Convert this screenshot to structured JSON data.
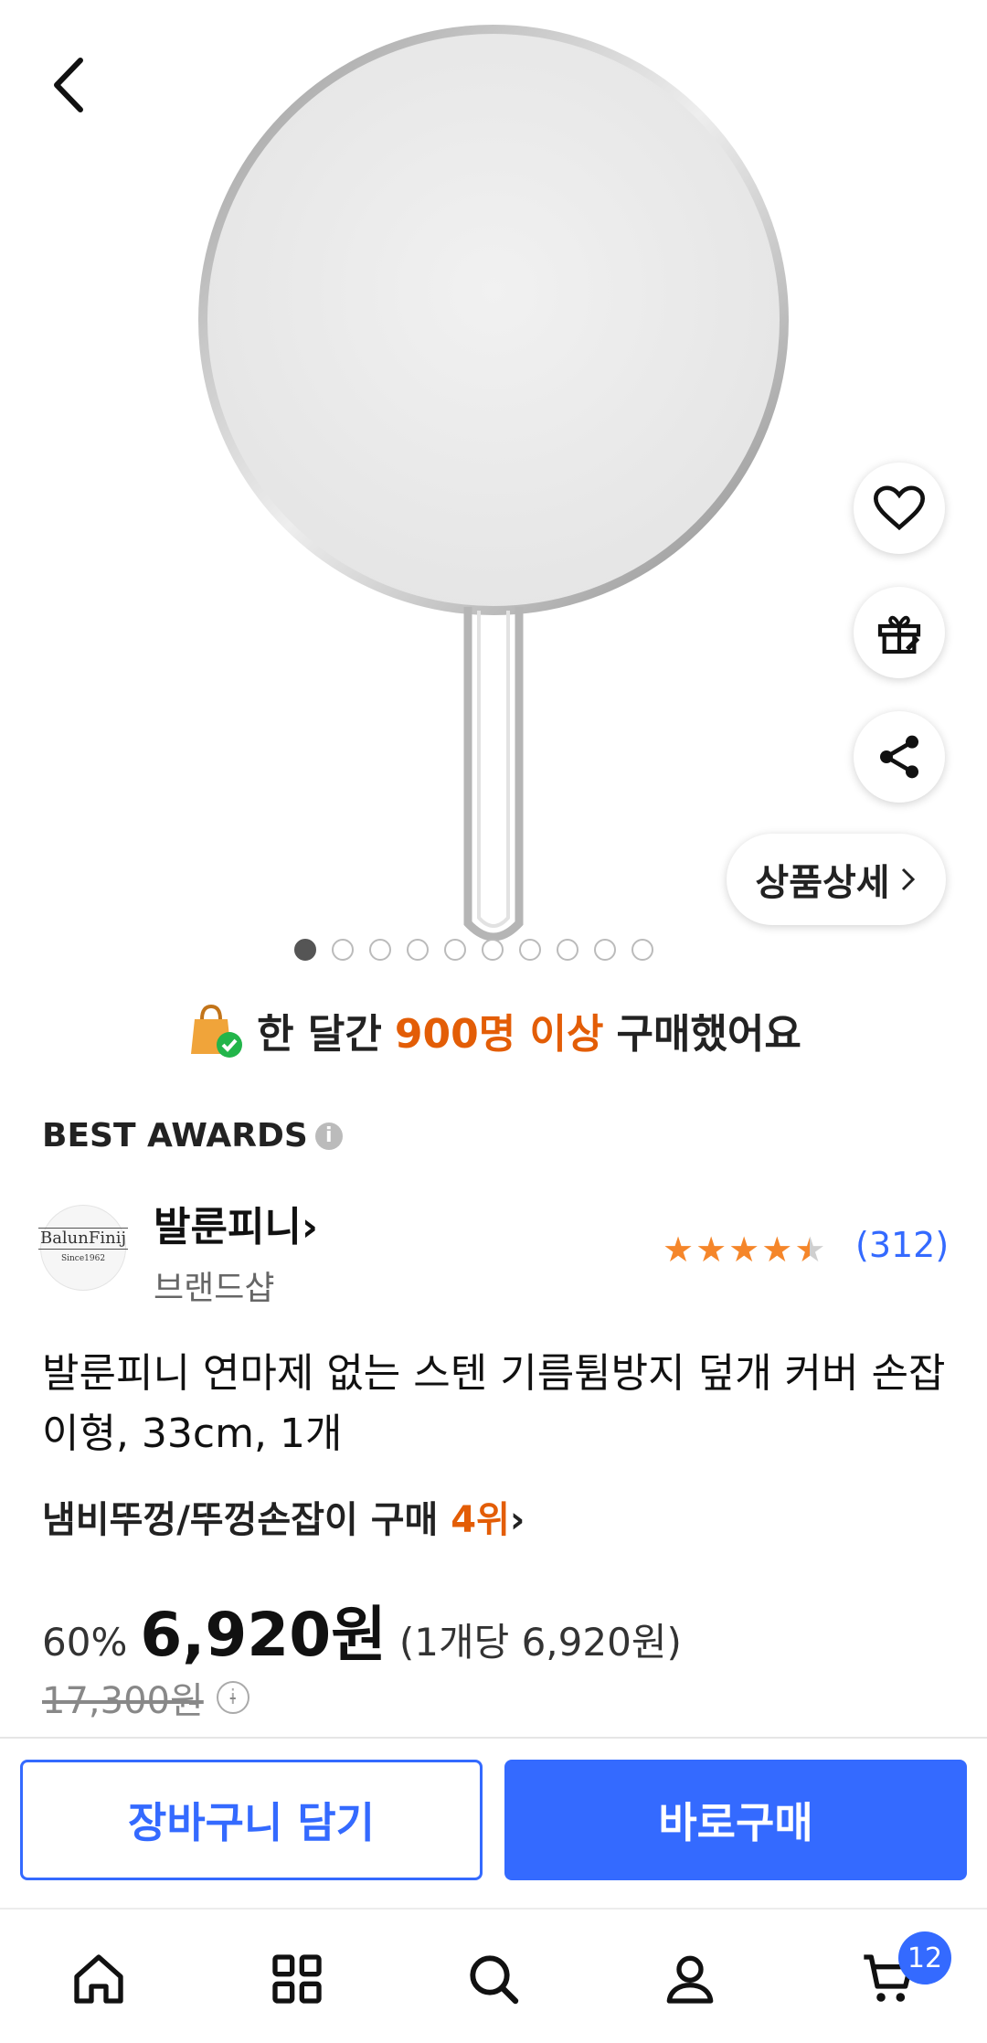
{
  "product": {
    "image_alt": "stainless splatter screen with handle",
    "detail_label": "상품상세",
    "image_count": 10,
    "active_image": 1
  },
  "purchase_notice": {
    "prefix": "한 달간",
    "highlight": "900명 이상",
    "suffix": "구매했어요"
  },
  "awards_label": "BEST AWARDS",
  "brand": {
    "logo_text": "BalunFinij",
    "logo_since": "Since1962",
    "name": "발룬피니",
    "sub": "브랜드샵"
  },
  "rating": {
    "stars": 4.5,
    "review_count": "(312)"
  },
  "title": "발룬피니 연마제 없는 스텐 기름튐방지 덮개 커버 손잡이형, 33cm, 1개",
  "rank": {
    "category": "냄비뚜껑/뚜껑손잡이 구매",
    "position": "4위"
  },
  "price": {
    "discount": "60%",
    "sale": "6,920원",
    "unit": "(1개당 6,920원)",
    "original": "17,300원"
  },
  "actions": {
    "cart": "장바구니 담기",
    "buy": "바로구매"
  },
  "nav": {
    "items": [
      "home-icon",
      "category-icon",
      "search-icon",
      "mypage-icon",
      "cart-icon"
    ],
    "cart_badge": "12"
  },
  "colors": {
    "accent": "#346aff",
    "highlight": "#e35d06",
    "star": "#f5862a"
  }
}
